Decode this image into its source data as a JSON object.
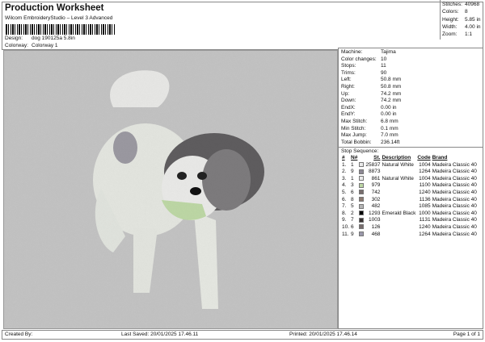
{
  "header": {
    "title": "Production Worksheet",
    "subtitle": "Wilcom EmbroideryStudio – Level 3 Advanced",
    "design_label": "Design:",
    "design_value": "dog 190125a 5.8in",
    "colorway_label": "Colorway:",
    "colorway_value": "Colorway 1"
  },
  "stats": [
    {
      "label": "Stitches:",
      "value": "40968"
    },
    {
      "label": "Colors:",
      "value": "8"
    },
    {
      "label": "Height:",
      "value": "5.85 in"
    },
    {
      "label": "Width:",
      "value": "4.00 in"
    },
    {
      "label": "Zoom:",
      "value": "1:1"
    }
  ],
  "info": [
    {
      "label": "Machine:",
      "value": "Tajima"
    },
    {
      "label": "Color changes:",
      "value": "10"
    },
    {
      "label": "Stops:",
      "value": "11"
    },
    {
      "label": "Trims:",
      "value": "90"
    },
    {
      "label": "Left:",
      "value": "50.8 mm"
    },
    {
      "label": "Right:",
      "value": "50.8 mm"
    },
    {
      "label": "Up:",
      "value": "74.2 mm"
    },
    {
      "label": "Down:",
      "value": "74.2 mm"
    },
    {
      "label": "EndX:",
      "value": "0.00 in"
    },
    {
      "label": "EndY:",
      "value": "0.00 in"
    },
    {
      "label": "Max Stitch:",
      "value": "6.8 mm"
    },
    {
      "label": "Min Stitch:",
      "value": "0.1 mm"
    },
    {
      "label": "Max Jump:",
      "value": "7.0 mm"
    },
    {
      "label": "Total Bobbin:",
      "value": "236.14ft"
    }
  ],
  "stop_sequence": {
    "title": "Stop Sequence:",
    "headers": [
      "#",
      "N#",
      "St.",
      "Description",
      "Code",
      "Brand"
    ],
    "rows": [
      {
        "n": "1.",
        "needle": "1",
        "color": "#ebebeb",
        "st": "25837",
        "desc": "Natural White",
        "code": "1004",
        "brand": "Madeira Classic 40"
      },
      {
        "n": "2.",
        "needle": "9",
        "color": "#8d8894",
        "st": "8873",
        "desc": "",
        "code": "1264",
        "brand": "Madeira Classic 40"
      },
      {
        "n": "3.",
        "needle": "1",
        "color": "#ebebeb",
        "st": "861",
        "desc": "Natural White",
        "code": "1004",
        "brand": "Madeira Classic 40"
      },
      {
        "n": "4.",
        "needle": "3",
        "color": "#bcd6a4",
        "st": "979",
        "desc": "",
        "code": "1100",
        "brand": "Madeira Classic 40"
      },
      {
        "n": "5.",
        "needle": "6",
        "color": "#776d6d",
        "st": "742",
        "desc": "",
        "code": "1240",
        "brand": "Madeira Classic 40"
      },
      {
        "n": "6.",
        "needle": "8",
        "color": "#8c7a70",
        "st": "302",
        "desc": "",
        "code": "1136",
        "brand": "Madeira Classic 40"
      },
      {
        "n": "7.",
        "needle": "5",
        "color": "#b4b4b4",
        "st": "482",
        "desc": "",
        "code": "1085",
        "brand": "Madeira Classic 40"
      },
      {
        "n": "8.",
        "needle": "2",
        "color": "#000000",
        "st": "1293",
        "desc": "Emerald Black",
        "code": "1000",
        "brand": "Madeira Classic 40"
      },
      {
        "n": "9.",
        "needle": "7",
        "color": "#3a3434",
        "st": "1003",
        "desc": "",
        "code": "1131",
        "brand": "Madeira Classic 40"
      },
      {
        "n": "10.",
        "needle": "6",
        "color": "#776d6d",
        "st": "126",
        "desc": "",
        "code": "1240",
        "brand": "Madeira Classic 40"
      },
      {
        "n": "11.",
        "needle": "9",
        "color": "#9a98aa",
        "st": "468",
        "desc": "",
        "code": "1264",
        "brand": "Madeira Classic 40"
      }
    ]
  },
  "footer": {
    "created_by": "Created By:",
    "last_saved": "Last Saved: 20/01/2025 17.46.11",
    "printed": "Printed: 20/01/2025 17.46.14",
    "page": "Page 1 of 1"
  }
}
